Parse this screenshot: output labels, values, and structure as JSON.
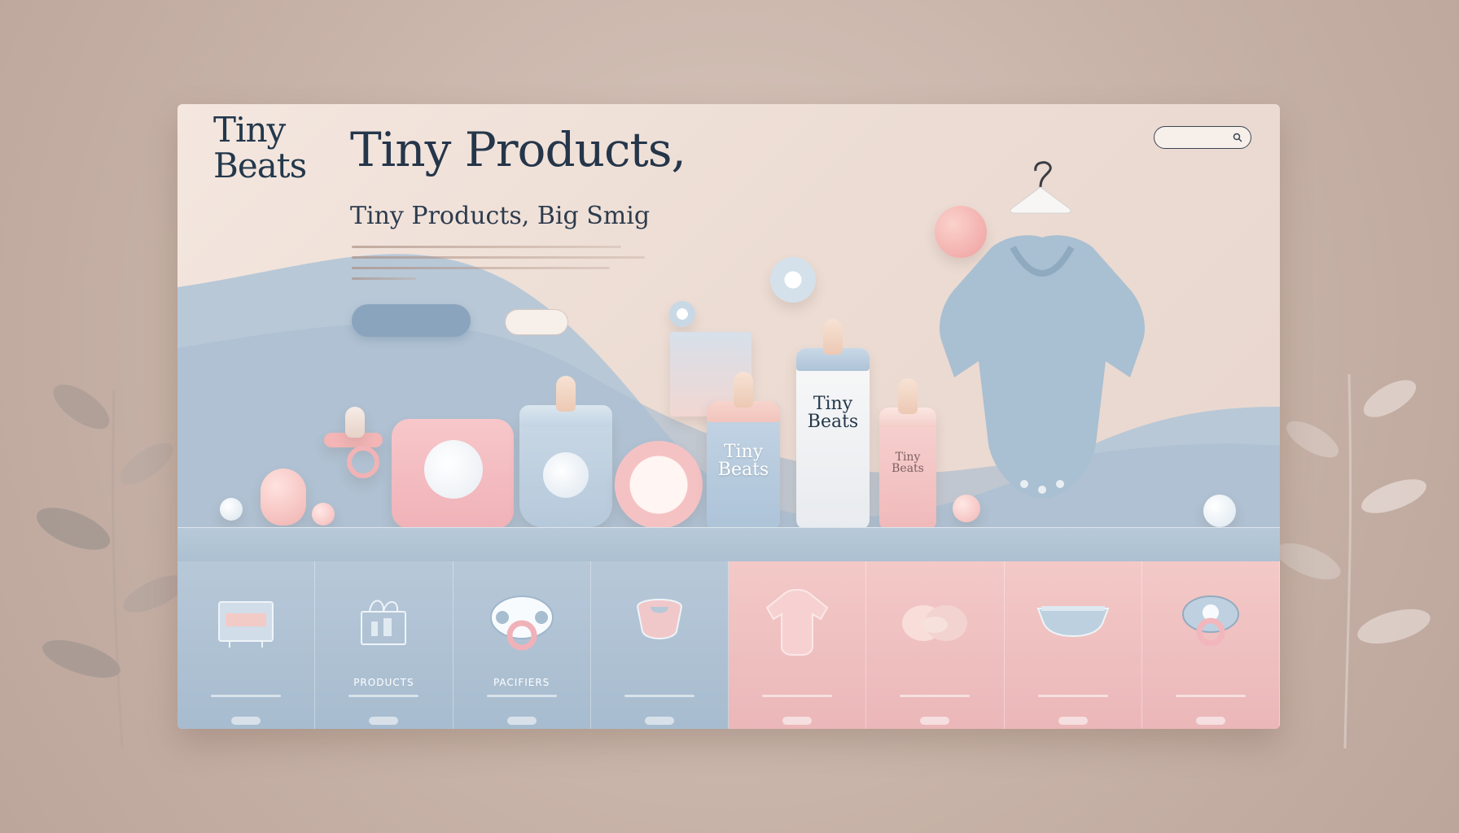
{
  "brand": {
    "name_line1": "Tiny",
    "name_line2": "Beats",
    "tagline": ""
  },
  "nav": {
    "items": [
      "",
      "",
      "",
      "",
      ""
    ]
  },
  "search": {
    "label": ""
  },
  "hero": {
    "headline": "Tiny Products,",
    "subheadline": "Tiny Products, Big Smig",
    "primary_cta": "",
    "secondary_cta": ""
  },
  "products": {
    "bottle_label_line1": "Tiny",
    "bottle_label_line2": "Beats",
    "tall_bottle_label_line1": "Tiny",
    "tall_bottle_label_line2": "Beats",
    "pink_bottle_label_line1": "Tiny",
    "pink_bottle_label_line2": "Beats"
  },
  "categories": [
    {
      "label": "",
      "theme": "blue",
      "icon": "storage-box-icon"
    },
    {
      "label": "PRODUCTS",
      "theme": "blue",
      "icon": "gift-basket-icon"
    },
    {
      "label": "PACIFIERS",
      "theme": "blue",
      "icon": "pacifier-icon"
    },
    {
      "label": "",
      "theme": "blue",
      "icon": "bib-icon"
    },
    {
      "label": "",
      "theme": "pink",
      "icon": "onesie-icon"
    },
    {
      "label": "",
      "theme": "pink",
      "icon": "cushion-icon"
    },
    {
      "label": "",
      "theme": "pink",
      "icon": "diaper-icon"
    },
    {
      "label": "",
      "theme": "pink",
      "icon": "pacifier-icon"
    }
  ],
  "colors": {
    "brand_navy": "#25364a",
    "baby_blue": "#a7bccf",
    "baby_pink": "#ebb7b9",
    "cream": "#f4e7df"
  }
}
